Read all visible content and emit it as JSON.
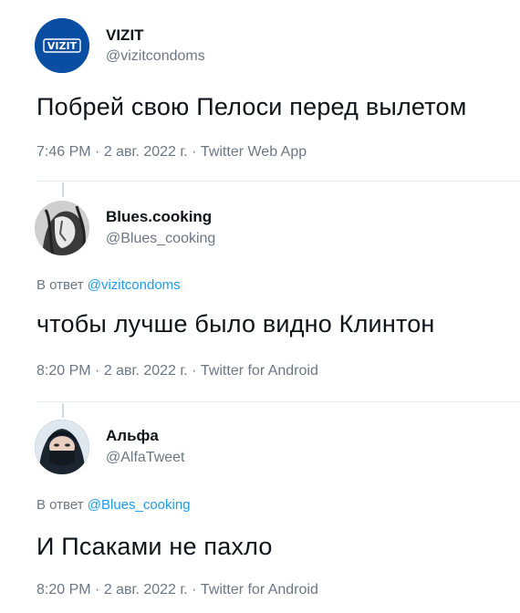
{
  "tweets": [
    {
      "name": "VIZIT",
      "handle": "@vizitcondoms",
      "avatar_text": "VIZIT",
      "text": "Побрей свою Пелоси перед вылетом",
      "time": "7:46 PM",
      "date": "2 авг. 2022 г.",
      "source": "Twitter Web App"
    },
    {
      "name": "Blues.cooking",
      "handle": "@Blues_cooking",
      "reply_prefix": "В ответ",
      "reply_to": "@vizitcondoms",
      "text": "чтобы лучше было видно Клинтон",
      "time": "8:20 PM",
      "date": "2 авг. 2022 г.",
      "source": "Twitter for Android"
    },
    {
      "name": "Альфа",
      "handle": "@AlfaTweet",
      "reply_prefix": "В ответ",
      "reply_to": "@Blues_cooking",
      "text": "И Псаками не пахло",
      "time": "8:20 PM",
      "date": "2 авг. 2022 г.",
      "source": "Twitter for Android"
    }
  ],
  "separator": " · ",
  "colors": {
    "link": "#1d9bf0",
    "muted": "#6b7783",
    "text": "#0f1419",
    "vizit_blue": "#0a4ea3"
  }
}
